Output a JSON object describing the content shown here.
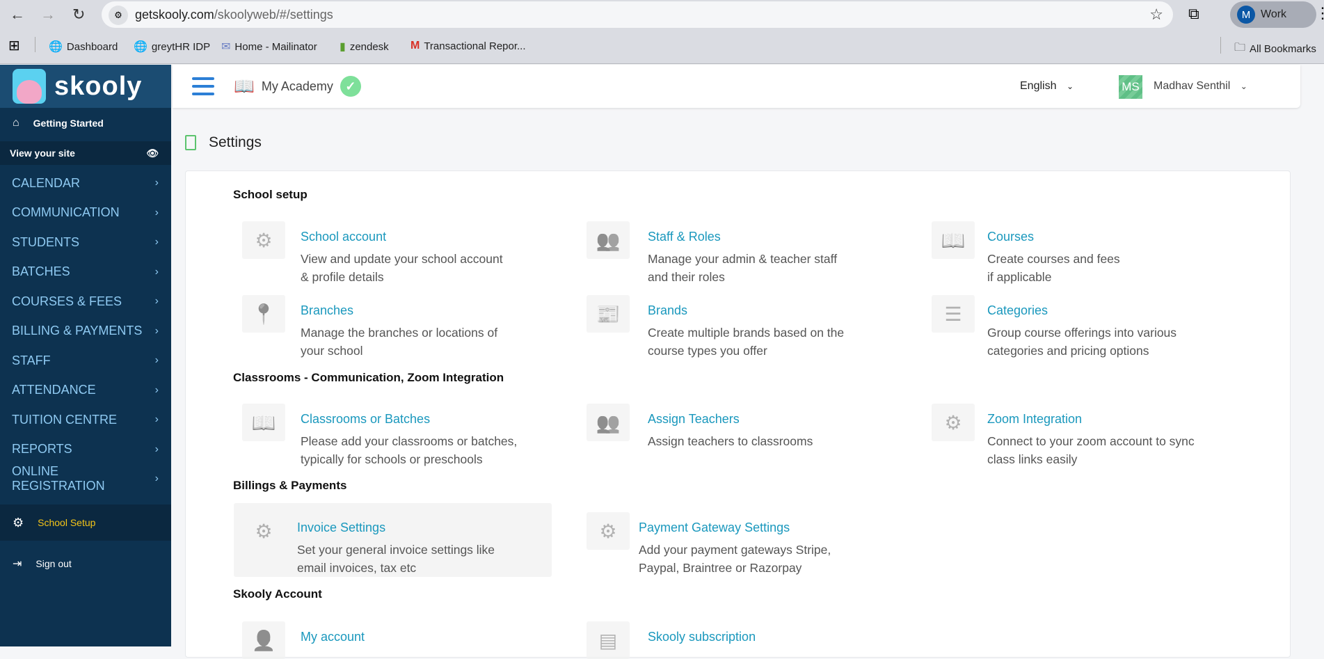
{
  "browser": {
    "url_host": "getskooly.com",
    "url_path": "/skoolyweb/#/settings",
    "profile_initial": "M",
    "profile_label": "Work",
    "bookmarks": [
      {
        "label": "Dashboard",
        "icon": "globe-icon"
      },
      {
        "label": "greytHR IDP",
        "icon": "globe-icon"
      },
      {
        "label": "Home - Mailinator",
        "icon": "mailinator-icon"
      },
      {
        "label": "zendesk",
        "icon": "zendesk-icon"
      },
      {
        "label": "Transactional Repor...",
        "icon": "gmail-icon"
      }
    ],
    "all_bookmarks": "All Bookmarks"
  },
  "sidebar": {
    "logo": "skooly",
    "getting_started": "Getting Started",
    "view_site": "View your site",
    "menu": [
      "CALENDAR",
      "COMMUNICATION",
      "STUDENTS",
      "BATCHES",
      "COURSES & FEES",
      "BILLING & PAYMENTS",
      "STAFF",
      "ATTENDANCE",
      "TUITION CENTRE",
      "REPORTS",
      "ONLINE REGISTRATION"
    ],
    "school_setup": "School Setup",
    "sign_out": "Sign out"
  },
  "header": {
    "academy": "My Academy",
    "language": "English",
    "user_initials": "MS",
    "user_name": "Madhav Senthil"
  },
  "page": {
    "title": "Settings"
  },
  "sections": {
    "school_setup": {
      "title": "School setup",
      "items": [
        {
          "title": "School account",
          "desc1": "View and update your school account",
          "desc2": "& profile details"
        },
        {
          "title": "Staff & Roles",
          "desc1": "Manage your admin & teacher staff",
          "desc2": "and their roles"
        },
        {
          "title": "Courses",
          "desc1": "Create courses and fees",
          "desc2": "if applicable"
        },
        {
          "title": "Branches",
          "desc1": "Manage the branches or locations of",
          "desc2": "your school"
        },
        {
          "title": "Brands",
          "desc1": "Create multiple brands based on the",
          "desc2": "course types you offer"
        },
        {
          "title": "Categories",
          "desc1": "Group course offerings into various",
          "desc2": "categories and pricing options"
        }
      ]
    },
    "classrooms": {
      "title": "Classrooms - Communication, Zoom Integration",
      "items": [
        {
          "title": "Classrooms or Batches",
          "desc1": "Please add your classrooms or batches,",
          "desc2": "typically for schools or preschools"
        },
        {
          "title": "Assign Teachers",
          "desc1": "Assign teachers to classrooms",
          "desc2": ""
        },
        {
          "title": "Zoom Integration",
          "desc1": "Connect to your zoom account to sync",
          "desc2": "class links easily"
        }
      ]
    },
    "billing": {
      "title": "Billings & Payments",
      "items": [
        {
          "title": "Invoice Settings",
          "desc1": "Set your general invoice settings like",
          "desc2": "email invoices, tax etc"
        },
        {
          "title": "Payment Gateway Settings",
          "desc1": "Add your payment gateways Stripe,",
          "desc2": "Paypal, Braintree or Razorpay"
        }
      ]
    },
    "account": {
      "title": "Skooly Account",
      "items": [
        {
          "title": "My account"
        },
        {
          "title": "Skooly subscription"
        }
      ]
    }
  }
}
